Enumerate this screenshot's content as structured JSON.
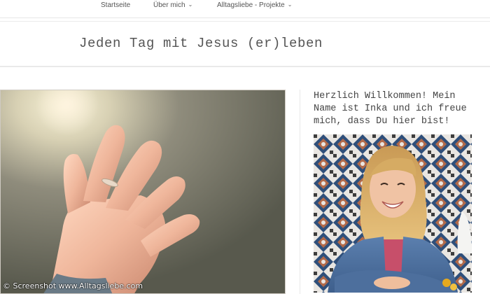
{
  "nav": {
    "items": [
      {
        "label": "Startseite",
        "has_dropdown": false
      },
      {
        "label": "Über mich",
        "has_dropdown": true
      },
      {
        "label": "Alltagsliebe - Projekte",
        "has_dropdown": true
      }
    ],
    "dropdown_icon": "⌄"
  },
  "header": {
    "title": "Jeden Tag mit Jesus (er)leben"
  },
  "main": {
    "hero_image": "hand-reaching-into-sunlight",
    "watermark": "© Screenshot www.Alltagsliebe.com"
  },
  "sidebar": {
    "welcome": "Herzlich Willkommen! Mein Name ist Inka und ich freue mich, dass Du hier bist!",
    "portrait": "smiling-woman-denim-jacket-tiled-wall"
  },
  "colors": {
    "text": "#555555",
    "nav_text": "#555555",
    "border": "#e6e6e6"
  }
}
